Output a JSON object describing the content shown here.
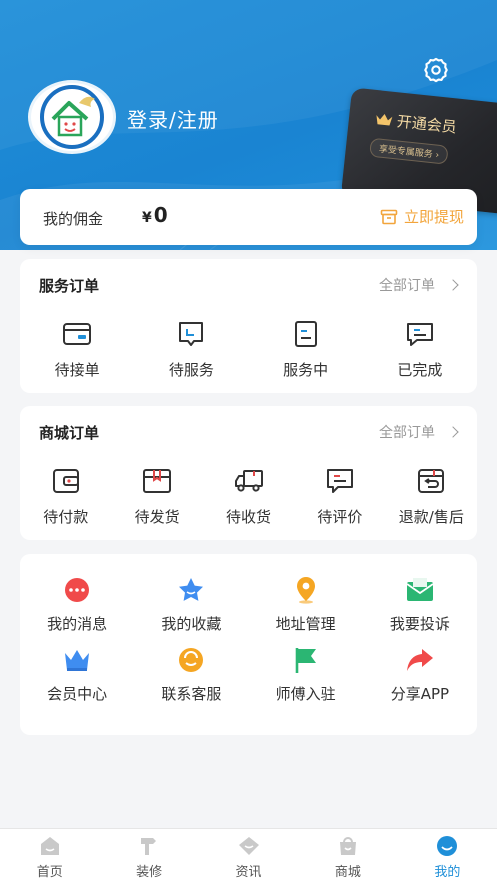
{
  "header": {
    "login_label": "登录/注册",
    "vip_card": {
      "title": "开通会员",
      "subtitle": "享受专属服务 ›",
      "accent": "#f3d9a4"
    }
  },
  "commission": {
    "label": "我的佣金",
    "currency": "¥",
    "amount": "0",
    "withdraw_label": "立即提现"
  },
  "service_orders": {
    "title": "服务订单",
    "all_label": "全部订单",
    "items": [
      {
        "label": "待接单",
        "icon": "wallet-icon"
      },
      {
        "label": "待服务",
        "icon": "inbox-icon"
      },
      {
        "label": "服务中",
        "icon": "document-icon"
      },
      {
        "label": "已完成",
        "icon": "chat-done-icon"
      }
    ]
  },
  "mall_orders": {
    "title": "商城订单",
    "all_label": "全部订单",
    "items": [
      {
        "label": "待付款",
        "icon": "wallet-icon"
      },
      {
        "label": "待发货",
        "icon": "package-icon"
      },
      {
        "label": "待收货",
        "icon": "truck-icon"
      },
      {
        "label": "待评价",
        "icon": "comment-icon"
      },
      {
        "label": "退款/售后",
        "icon": "refund-icon"
      }
    ]
  },
  "tools": {
    "row1": [
      {
        "label": "我的消息",
        "icon": "message-icon",
        "color": "#f04a4a"
      },
      {
        "label": "我的收藏",
        "icon": "star-icon",
        "color": "#3f8df0"
      },
      {
        "label": "地址管理",
        "icon": "location-pin-icon",
        "color": "#f5a623"
      },
      {
        "label": "我要投诉",
        "icon": "mail-icon",
        "color": "#2bb673"
      }
    ],
    "row2": [
      {
        "label": "会员中心",
        "icon": "crown-icon",
        "color": "#3f8df0"
      },
      {
        "label": "联系客服",
        "icon": "customer-service-icon",
        "color": "#f5a623"
      },
      {
        "label": "师傅入驻",
        "icon": "flag-icon",
        "color": "#2bb673"
      },
      {
        "label": "分享APP",
        "icon": "share-icon",
        "color": "#f04a4a"
      }
    ]
  },
  "tabbar": {
    "tabs": [
      {
        "label": "首页",
        "icon": "home-icon"
      },
      {
        "label": "装修",
        "icon": "hammer-icon"
      },
      {
        "label": "资讯",
        "icon": "diamond-icon"
      },
      {
        "label": "商城",
        "icon": "shop-icon"
      },
      {
        "label": "我的",
        "icon": "profile-icon",
        "active": true
      }
    ],
    "active_color": "#1f8fd8"
  },
  "colors": {
    "brand": "#1f8fd8",
    "accent_orange": "#f2a53c"
  }
}
